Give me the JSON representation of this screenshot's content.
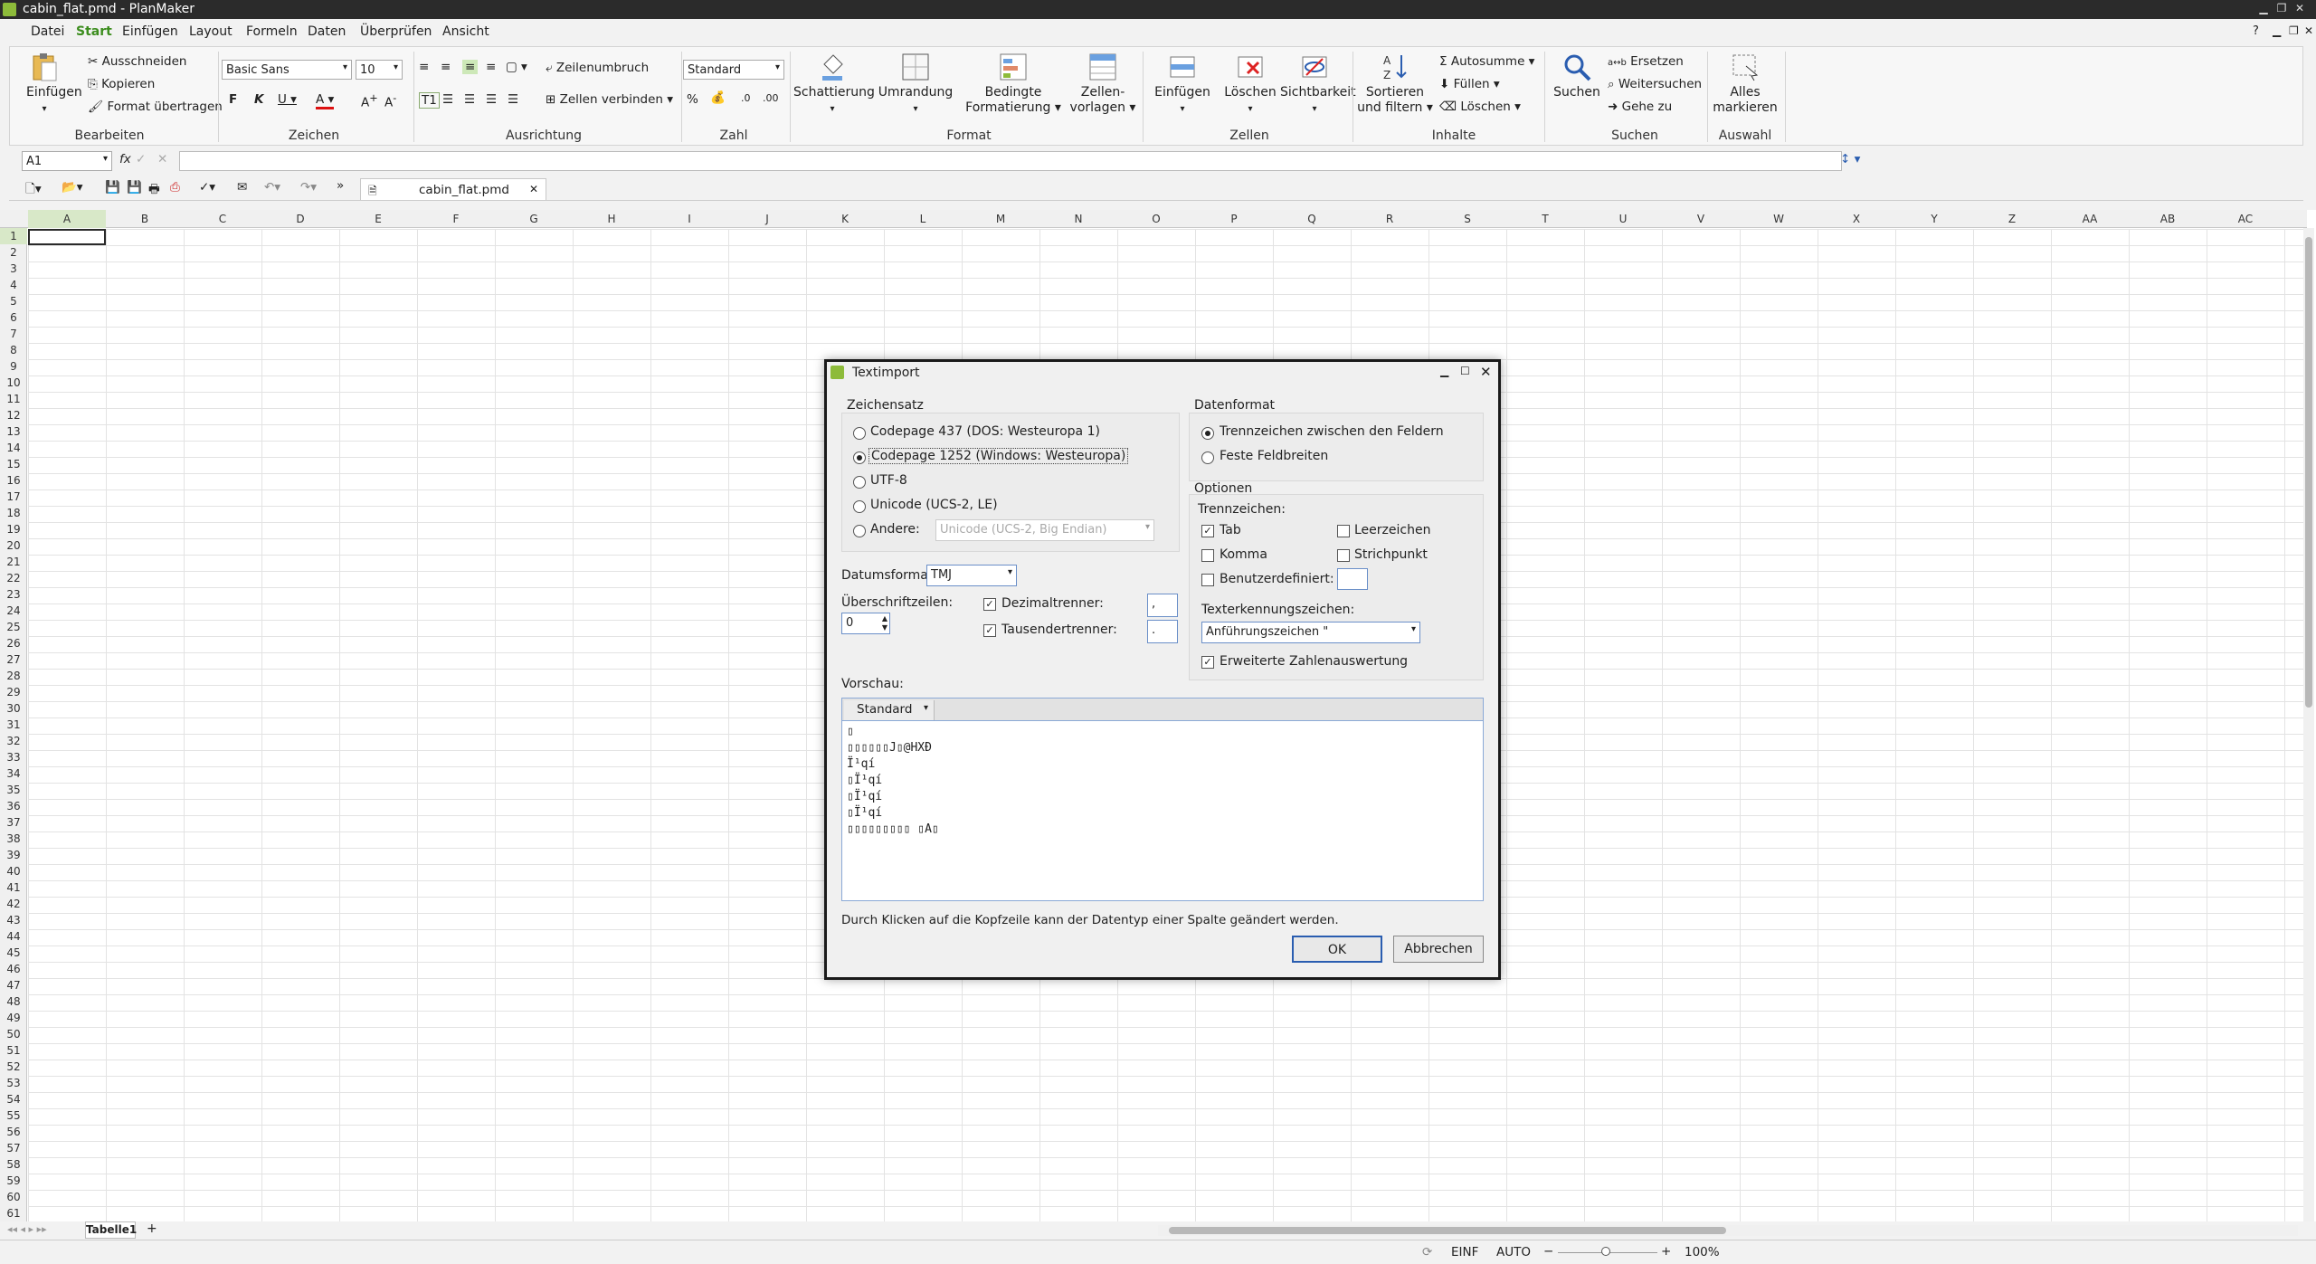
{
  "window": {
    "title": "cabin_flat.pmd - PlanMaker"
  },
  "menu": [
    "Datei",
    "Start",
    "Einfügen",
    "Layout",
    "Formeln",
    "Daten",
    "Überprüfen",
    "Ansicht"
  ],
  "ribbon": {
    "bearbeiten": {
      "label": "Bearbeiten",
      "einfuegen": "Einfügen",
      "ausschneiden": "Ausschneiden",
      "kopieren": "Kopieren",
      "format": "Format übertragen"
    },
    "zeichen": {
      "label": "Zeichen",
      "font": "Basic Sans",
      "size": "10"
    },
    "ausrichtung": {
      "label": "Ausrichtung",
      "zeilenumbruch": "Zeilenumbruch",
      "verbinden": "Zellen verbinden"
    },
    "zahl": {
      "label": "Zahl",
      "format": "Standard"
    },
    "format": {
      "label": "Format",
      "schattierung": "Schattierung",
      "umrandung": "Umrandung",
      "bedingte1": "Bedingte",
      "bedingte2": "Formatierung",
      "vorlagen1": "Zellen-",
      "vorlagen2": "vorlagen"
    },
    "zellen": {
      "label": "Zellen",
      "einfuegen": "Einfügen",
      "loeschen": "Löschen",
      "sichtbarkeit": "Sichtbarkeit"
    },
    "inhalte": {
      "label": "Inhalte",
      "sort1": "Sortieren",
      "sort2": "und filtern",
      "autosumme": "Autosumme",
      "fuellen": "Füllen",
      "loeschen": "Löschen"
    },
    "suchen": {
      "label": "Suchen",
      "suchen": "Suchen",
      "ersetzen": "Ersetzen",
      "weiter": "Weitersuchen",
      "gehe": "Gehe zu"
    },
    "auswahl": {
      "label": "Auswahl",
      "alles1": "Alles",
      "alles2": "markieren"
    }
  },
  "formula": {
    "cellref": "A1",
    "fx": "fx"
  },
  "doc_tab": "cabin_flat.pmd",
  "columns": [
    "A",
    "B",
    "C",
    "D",
    "E",
    "F",
    "G",
    "H",
    "I",
    "J",
    "K",
    "L",
    "M",
    "N",
    "O",
    "P",
    "Q",
    "R",
    "S",
    "T",
    "U",
    "V",
    "W",
    "X",
    "Y",
    "Z",
    "AA",
    "AB",
    "AC"
  ],
  "sheet_tab": "Tabelle1",
  "status": {
    "ins": "EINF",
    "auto": "AUTO",
    "zoom": "100%"
  },
  "dialog": {
    "title": "Textimport",
    "zeichensatz": {
      "label": "Zeichensatz",
      "opt1": "Codepage 437 (DOS: Westeuropa 1)",
      "opt2": "Codepage 1252 (Windows: Westeuropa)",
      "opt3": "UTF-8",
      "opt4": "Unicode (UCS-2, LE)",
      "opt5": "Andere:",
      "andere_value": "Unicode (UCS-2, Big Endian)"
    },
    "datenformat": {
      "label": "Datenformat",
      "opt1": "Trennzeichen zwischen den Feldern",
      "opt2": "Feste Feldbreiten"
    },
    "optionen": {
      "label": "Optionen",
      "trennzeichen": "Trennzeichen:",
      "tab": "Tab",
      "leerzeichen": "Leerzeichen",
      "komma": "Komma",
      "strichpunkt": "Strichpunkt",
      "benutzer": "Benutzerdefiniert:",
      "textkennung": "Texterkennungszeichen:",
      "textkennung_value": "Anführungszeichen \"",
      "erweitert": "Erweiterte Zahlenauswertung"
    },
    "datumsformat": {
      "label": "Datumsformat:",
      "value": "TMJ"
    },
    "ueberschrift": {
      "label": "Überschriftzeilen:",
      "value": "0"
    },
    "dezimal": {
      "label": "Dezimaltrenner:",
      "value": ","
    },
    "tausend": {
      "label": "Tausendertrenner:",
      "value": "."
    },
    "vorschau": {
      "label": "Vorschau:",
      "column_type": "Standard",
      "lines": [
        "▯",
        "▯▯▯▯▯▯J▯@HXÐ",
        "Ï¹qí",
        "▯Ï¹qí",
        "▯Ï¹qí",
        "▯Ï¹qí",
        "▯▯▯▯▯▯▯▯▯ ▯A▯"
      ]
    },
    "hint": "Durch Klicken auf die Kopfzeile kann der Datentyp einer Spalte geändert werden.",
    "ok": "OK",
    "abbrechen": "Abbrechen"
  }
}
